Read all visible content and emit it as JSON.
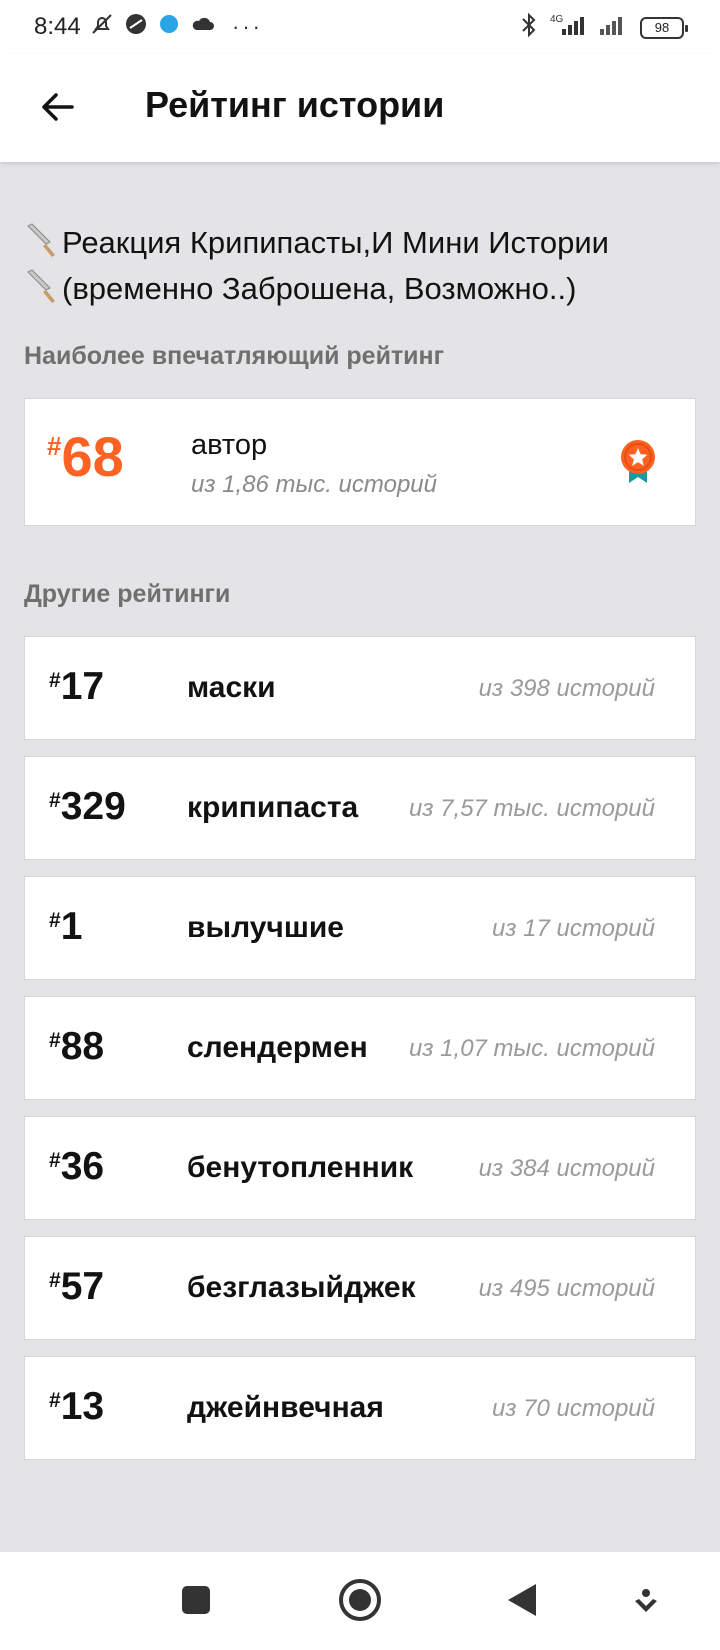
{
  "status_bar": {
    "time": "8:44",
    "network": "4G",
    "battery": "98",
    "more": "···"
  },
  "header": {
    "title": "Рейтинг истории"
  },
  "story": {
    "title_line1": "Реакция Крипипасты,И Мини Истории",
    "title_line2": "(временно Заброшена, Возможно..)"
  },
  "featured": {
    "section_label": "Наиболее впечатляющий рейтинг",
    "hash": "#",
    "rank": "68",
    "tag": "автор",
    "count": "из 1,86 тыс. историй",
    "accent_color": "#ff6122",
    "badge_icon": "ribbon-star-icon"
  },
  "others": {
    "section_label": "Другие рейтинги",
    "items": [
      {
        "hash": "#",
        "rank": "17",
        "tag": "маски",
        "count": "из 398 историй"
      },
      {
        "hash": "#",
        "rank": "329",
        "tag": "крипипаста",
        "count": "из 7,57 тыс. историй"
      },
      {
        "hash": "#",
        "rank": "1",
        "tag": "вылучшие",
        "count": "из 17 историй"
      },
      {
        "hash": "#",
        "rank": "88",
        "tag": "слендермен",
        "count": "из 1,07 тыс. историй"
      },
      {
        "hash": "#",
        "rank": "36",
        "tag": "бенутопленник",
        "count": "из 384 историй"
      },
      {
        "hash": "#",
        "rank": "57",
        "tag": "безглазыйджек",
        "count": "из 495 историй"
      },
      {
        "hash": "#",
        "rank": "13",
        "tag": "джейнвечная",
        "count": "из 70 историй"
      }
    ]
  }
}
